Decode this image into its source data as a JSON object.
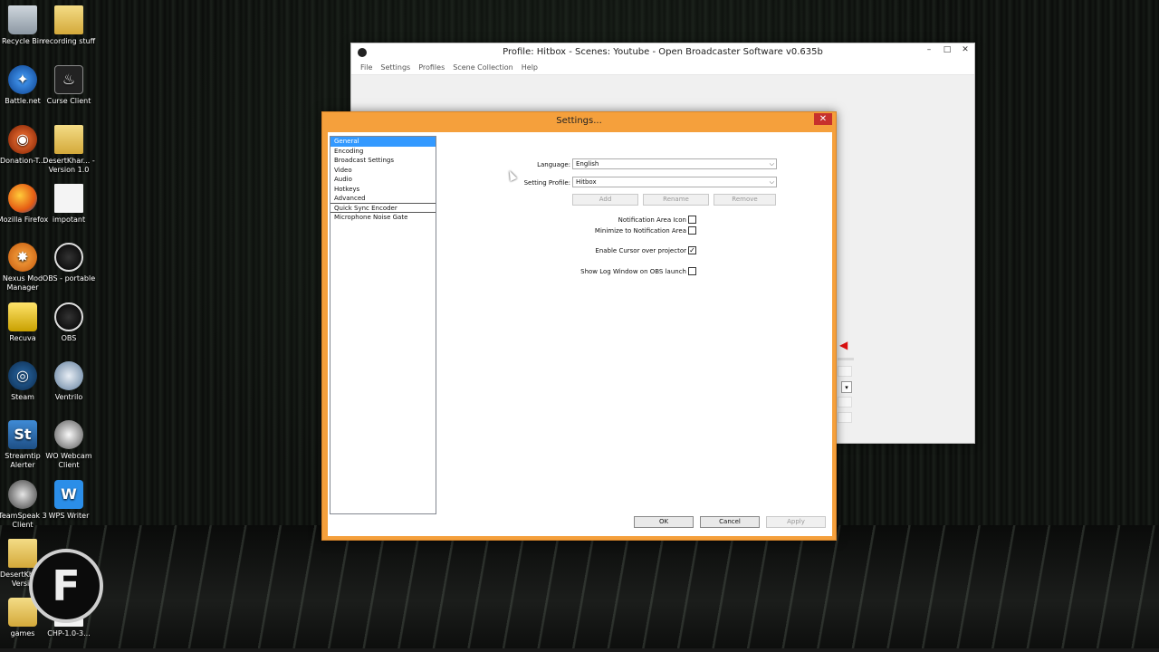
{
  "desktop": {
    "icons": [
      {
        "label": "Recycle Bin",
        "icon": "recycle-bin-icon"
      },
      {
        "label": "recording stuff",
        "icon": "folder-icon"
      },
      {
        "label": "Battle.net",
        "icon": "battlenet-icon"
      },
      {
        "label": "Curse Client",
        "icon": "curse-icon"
      },
      {
        "label": "Donation-T...",
        "icon": "donation-icon"
      },
      {
        "label": "DesertKhar... - Version 1.0",
        "icon": "folder-icon"
      },
      {
        "label": "Mozilla Firefox",
        "icon": "firefox-icon"
      },
      {
        "label": "impotant",
        "icon": "document-icon"
      },
      {
        "label": "Nexus Mod Manager",
        "icon": "nexus-icon"
      },
      {
        "label": "OBS - portable",
        "icon": "obs-icon"
      },
      {
        "label": "Recuva",
        "icon": "recuva-icon"
      },
      {
        "label": "OBS",
        "icon": "obs-icon"
      },
      {
        "label": "Steam",
        "icon": "steam-icon"
      },
      {
        "label": "Ventrilo",
        "icon": "ventrilo-icon"
      },
      {
        "label": "Streamtip Alerter",
        "icon": "streamtip-icon"
      },
      {
        "label": "WO Webcam Client",
        "icon": "webcam-icon"
      },
      {
        "label": "TeamSpeak 3 Client",
        "icon": "teamspeak-icon"
      },
      {
        "label": "WPS Writer",
        "icon": "wps-icon"
      },
      {
        "label": "DesertKh... - Versio",
        "icon": "folder-icon"
      },
      {
        "label": "games",
        "icon": "folder-icon"
      },
      {
        "label": "CHP-1.0-3...",
        "icon": "document-icon"
      }
    ],
    "logo_letter": "F"
  },
  "obs_window": {
    "title": "Profile: Hitbox - Scenes: Youtube - Open Broadcaster Software v0.635b",
    "menu": [
      "File",
      "Settings",
      "Profiles",
      "Scene Collection",
      "Help"
    ],
    "controls": {
      "minimize": "–",
      "maximize": "□",
      "close": "✕"
    }
  },
  "settings_dialog": {
    "title": "Settings...",
    "close": "✕",
    "categories": [
      "General",
      "Encoding",
      "Broadcast Settings",
      "Video",
      "Audio",
      "Hotkeys",
      "Advanced",
      "Quick Sync Encoder",
      "Microphone Noise Gate"
    ],
    "selected_category": "General",
    "general": {
      "language_label": "Language:",
      "language_value": "English",
      "profile_label": "Setting Profile:",
      "profile_value": "Hitbox",
      "add_label": "Add",
      "rename_label": "Rename",
      "remove_label": "Remove",
      "notification_icon_label": "Notification Area Icon",
      "notification_icon_checked": false,
      "minimize_notification_label": "Minimize to Notification Area",
      "minimize_notification_checked": false,
      "cursor_projector_label": "Enable Cursor over projector",
      "cursor_projector_checked": true,
      "log_window_label": "Show Log Window on OBS launch",
      "log_window_checked": false
    },
    "buttons": {
      "ok": "OK",
      "cancel": "Cancel",
      "apply": "Apply"
    }
  }
}
